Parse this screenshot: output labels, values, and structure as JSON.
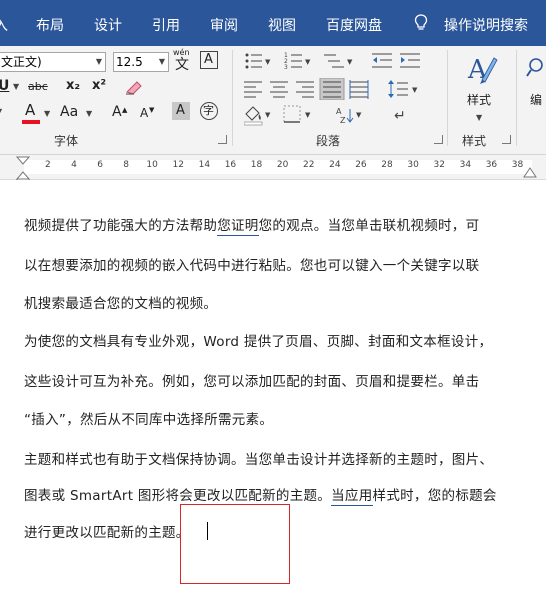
{
  "ribbon_tabs": [
    {
      "label": "入"
    },
    {
      "label": "布局"
    },
    {
      "label": "设计"
    },
    {
      "label": "引用"
    },
    {
      "label": "审阅"
    },
    {
      "label": "视图"
    },
    {
      "label": "百度网盘"
    },
    {
      "label": "操作说明搜索"
    }
  ],
  "tell_me_icon": "lightbulb-icon",
  "font": {
    "name_value": "文正文)",
    "size_value": "12.5",
    "wen_label": "wén",
    "wen_char": "文",
    "char_border_char": "A",
    "strike_label": "abc",
    "subscript_label": "x₂",
    "superscript_label": "x²",
    "font_color_label": "A",
    "change_case_label": "Aa",
    "grow_label": "A",
    "shrink_label": "A",
    "shading_label": "A",
    "enclose_label": "字",
    "group_label": "字体"
  },
  "paragraph": {
    "group_label": "段落"
  },
  "styles": {
    "button_label": "样式",
    "group_label": "样式",
    "edit_label": "编"
  },
  "ruler": {
    "ticks": [
      "2",
      "4",
      "6",
      "8",
      "10",
      "12",
      "14",
      "16",
      "18",
      "20",
      "22",
      "24",
      "26",
      "28",
      "30",
      "32",
      "34",
      "36",
      "38"
    ]
  },
  "document": {
    "lines": [
      {
        "before": "视频提供了功能强大的方法帮助",
        "underlined": "您证明",
        "after": "您的观点。当您单击联机视频时，可"
      },
      {
        "before": "以在想要添加的视频的嵌入代码中进行粘贴。您也可以键入一个关键字以联",
        "underlined": "",
        "after": ""
      },
      {
        "before": "机搜索最适合您的文档的视频。",
        "underlined": "",
        "after": ""
      },
      {
        "before": "为使您的文档具有专业外观，Word 提供了页眉、页脚、封面和文本框设计，",
        "underlined": "",
        "after": ""
      },
      {
        "before": "这些设计可互为补充。例如，您可以添加匹配的封面、页眉和提要栏。单击",
        "underlined": "",
        "after": ""
      },
      {
        "before": "“插入”，然后从不同库中选择所需元素。",
        "underlined": "",
        "after": ""
      },
      {
        "before": "主题和样式也有助于文档保持协调。当您单击设计并选择新的主题时，图片、",
        "underlined": "",
        "after": ""
      },
      {
        "before": "图表或 SmartArt 图形将会更改以匹配新的主题。",
        "underlined": "当应用",
        "after": "样式时，您的标题会"
      },
      {
        "before": "进行更改以匹配新的主题。",
        "underlined": "",
        "after": ""
      }
    ]
  },
  "colors": {
    "ribbon_tab_bg": "#2b579a",
    "ribbon_bg": "#f3f3f3",
    "font_color_red": "#e81123",
    "highlight_red_box": "#d62828",
    "grammar_underline": "#2b579a"
  }
}
